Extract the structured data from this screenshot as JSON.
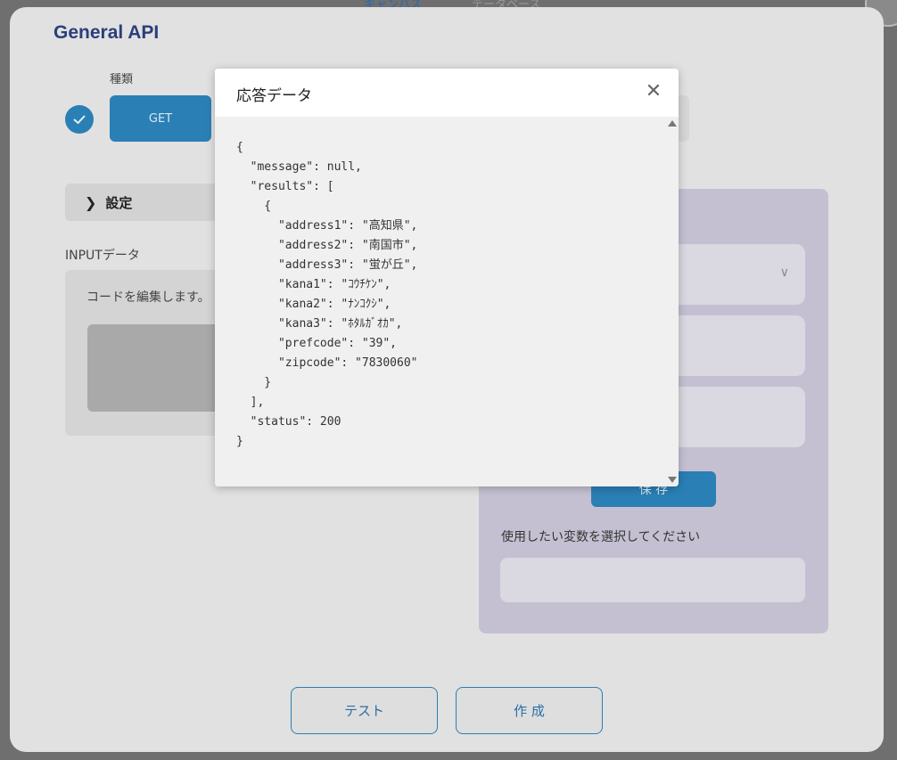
{
  "top_tabs": [
    "キャンバス",
    "データベース"
  ],
  "panel": {
    "title": "General API",
    "type_label": "種類",
    "method_button": "GET",
    "settings_label": "設定",
    "input_label": "INPUTデータ",
    "input_hint": "コードを編集します。",
    "save_button": "保 存",
    "variable_label": "使用したい変数を選択してください",
    "test_button": "テスト",
    "create_button": "作 成"
  },
  "modal": {
    "title": "応答データ",
    "close_icon": "close-icon",
    "json_lines": [
      "{",
      "  \"message\": null,",
      "  \"results\": [",
      "    {",
      "      \"address1\": \"高知県\",",
      "      \"address2\": \"南国市\",",
      "      \"address3\": \"蛍が丘\",",
      "      \"kana1\": \"ｺｳﾁｹﾝ\",",
      "      \"kana2\": \"ﾅﾝｺｸｼ\",",
      "      \"kana3\": \"ﾎﾀﾙｶﾞｵｶ\",",
      "      \"prefcode\": \"39\",",
      "      \"zipcode\": \"7830060\"",
      "    }",
      "  ],",
      "  \"status\": 200",
      "}"
    ]
  },
  "colors": {
    "accent": "#2a7fb5",
    "title": "#2a3f7a",
    "overlay_card": "#c4c0d2"
  }
}
